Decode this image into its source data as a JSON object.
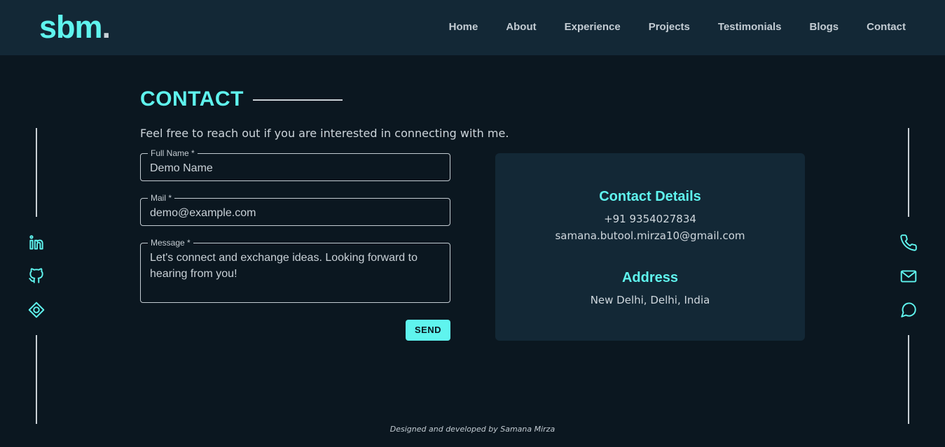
{
  "header": {
    "logo_text": "sbm",
    "logo_dot": ".",
    "nav": [
      "Home",
      "About",
      "Experience",
      "Projects",
      "Testimonials",
      "Blogs",
      "Contact"
    ]
  },
  "section": {
    "title": "CONTACT",
    "intro": "Feel free to reach out if you are interested in connecting with me."
  },
  "form": {
    "full_name": {
      "label": "Full Name *",
      "value": "Demo Name"
    },
    "mail": {
      "label": "Mail *",
      "value": "demo@example.com"
    },
    "message": {
      "label": "Message *",
      "value": "Let's connect and exchange ideas. Looking forward to hearing from you!"
    },
    "send_label": "SEND"
  },
  "card": {
    "contact_title": "Contact Details",
    "phone": "+91 9354027834",
    "email": "samana.butool.mirza10@gmail.com",
    "address_title": "Address",
    "address": "New Delhi, Delhi, India"
  },
  "left_icons": [
    "linkedin-icon",
    "github-icon",
    "portfolio-icon"
  ],
  "right_icons": [
    "phone-icon",
    "mail-icon",
    "chat-icon"
  ],
  "footer": {
    "text": "Designed and developed by Samana Mirza"
  },
  "colors": {
    "accent": "#5ff4ee",
    "background": "#0b1720",
    "panel": "#132836"
  }
}
